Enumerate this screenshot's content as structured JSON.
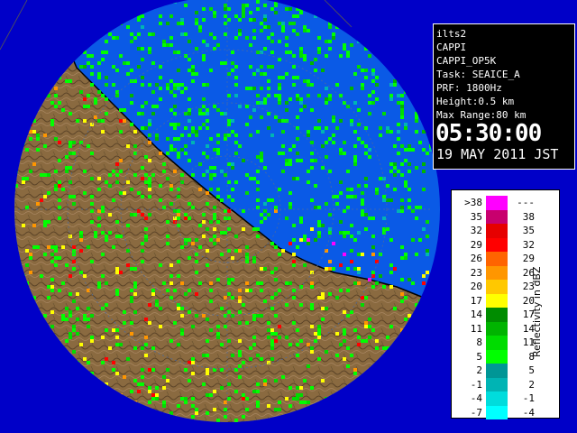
{
  "info": {
    "station": "ilts2",
    "product": "CAPPI",
    "product_code": "CAPPI_OP5K",
    "task": "Task: SEAICE_A",
    "prf": "PRF: 1800Hz",
    "height": "Height:0.5 km",
    "max_range": "Max Range:80 km",
    "time": "05:30:00",
    "date": "19 MAY 2011 JST"
  },
  "legend": {
    "unit": "Reflectivity in dBZ",
    "rows": [
      {
        "lo": ">38",
        "hi": "---",
        "color": "#ff00ff"
      },
      {
        "lo": "35",
        "hi": "38",
        "color": "#c8006e"
      },
      {
        "lo": "32",
        "hi": "35",
        "color": "#e60000"
      },
      {
        "lo": "29",
        "hi": "32",
        "color": "#ff0000"
      },
      {
        "lo": "26",
        "hi": "29",
        "color": "#ff6400"
      },
      {
        "lo": "23",
        "hi": "26",
        "color": "#ff9600"
      },
      {
        "lo": "20",
        "hi": "23",
        "color": "#ffc800"
      },
      {
        "lo": "17",
        "hi": "20",
        "color": "#ffff00"
      },
      {
        "lo": "14",
        "hi": "17",
        "color": "#008c00"
      },
      {
        "lo": "11",
        "hi": "14",
        "color": "#00b400"
      },
      {
        "lo": "8",
        "hi": "11",
        "color": "#00dc00"
      },
      {
        "lo": "5",
        "hi": "8",
        "color": "#00ff00"
      },
      {
        "lo": "2",
        "hi": "5",
        "color": "#009696"
      },
      {
        "lo": "-1",
        "hi": "2",
        "color": "#00b4b4"
      },
      {
        "lo": "-4",
        "hi": "-1",
        "color": "#00dcdc"
      },
      {
        "lo": "-7",
        "hi": "-4",
        "color": "#00ffff"
      }
    ]
  },
  "colors": {
    "sea": "#0a5ae6",
    "outside_range": "#0000c8",
    "land": "#8a6a40",
    "coastline": "#000000",
    "grid": "#4a6aa0"
  }
}
